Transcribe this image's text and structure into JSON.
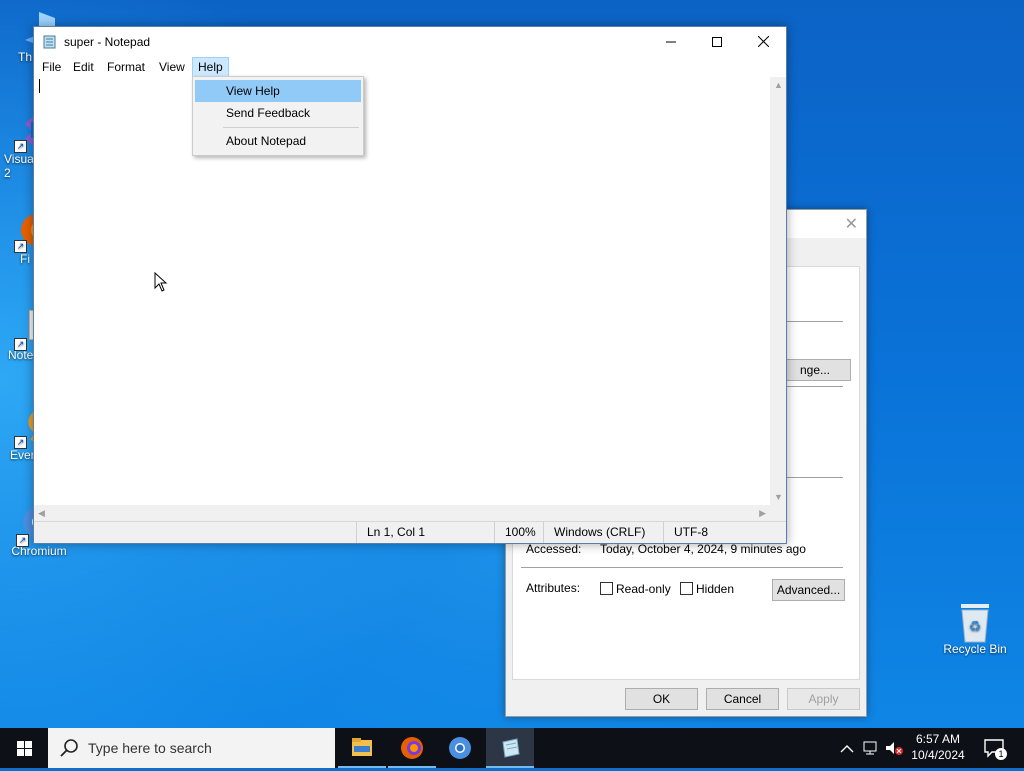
{
  "desktop": {
    "icons": [
      {
        "label": "Th"
      },
      {
        "label": "Visua\n2"
      },
      {
        "label": "Fi"
      },
      {
        "label": "Note"
      },
      {
        "label": "Ever"
      },
      {
        "label": "Chromium"
      },
      {
        "label": "Recycle Bin"
      }
    ]
  },
  "props_dialog": {
    "close_glyph": "✕",
    "change_button": "nge...",
    "accessed_label": "Accessed:",
    "accessed_value": "Today, October 4, 2024, 9 minutes ago",
    "attributes_label": "Attributes:",
    "readonly_label": "Read-only",
    "hidden_label": "Hidden",
    "advanced_button": "Advanced...",
    "ok_button": "OK",
    "cancel_button": "Cancel",
    "apply_button": "Apply"
  },
  "notepad": {
    "title": "super - Notepad",
    "menus": [
      "File",
      "Edit",
      "Format",
      "View",
      "Help"
    ],
    "status": {
      "position": "Ln 1, Col 1",
      "zoom": "100%",
      "line_ending": "Windows (CRLF)",
      "encoding": "UTF-8"
    },
    "help_menu": {
      "items": [
        "View Help",
        "Send Feedback",
        "About Notepad"
      ]
    }
  },
  "taskbar": {
    "search_placeholder": "Type here to search",
    "time": "6:57 AM",
    "date": "10/4/2024",
    "notification_count": "1"
  }
}
